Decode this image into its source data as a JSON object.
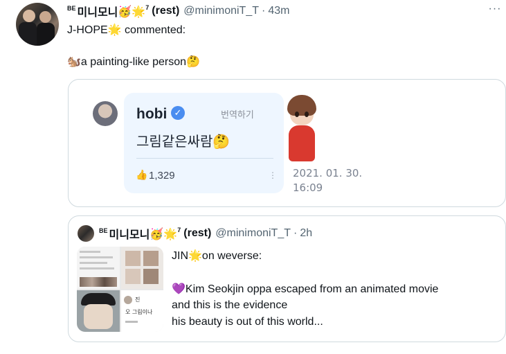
{
  "tweet": {
    "be_tag": "BE",
    "display_name": "미니모니",
    "name_emoji": "🥳",
    "star_emoji": "🌟",
    "superscript": "7",
    "rest_label": "(rest)",
    "handle": "@minimoniT_T",
    "separator": "·",
    "time": "43m",
    "more": "···",
    "line1_pre": "J-HOPE",
    "line1_emoji": "🌟",
    "line1_post": "commented:",
    "line2_emoji": "🐿️",
    "line2_text": "a painting-like person",
    "line2_emoji_end": "🤔"
  },
  "media_card": {
    "username": "hobi",
    "verified": "✓",
    "translate": "번역하기",
    "comment": "그림같은싸람",
    "comment_emoji": "🤔",
    "thumb": "👍",
    "like_count": "1,329",
    "dots": "⋮",
    "date_line1": "2021. 01. 30.",
    "date_line2": "16:09"
  },
  "quote": {
    "be_tag": "BE",
    "display_name": "미니모니",
    "name_emoji": "🥳",
    "star_emoji": "🌟",
    "superscript": "7",
    "rest_label": "(rest)",
    "handle": "@minimoniT_T",
    "separator": "·",
    "time": "2h",
    "line1_pre": "JIN",
    "line1_emoji": "🌟",
    "line1_post": "on weverse:",
    "heart": "💜",
    "line2": "Kim Seokjin oppa escaped from an animated movie",
    "line3": "and this is the evidence",
    "line4": "his beauty is out of this world...",
    "thumb_tile4_name": "진",
    "thumb_tile4_text": "오 그림이나"
  },
  "colors": {
    "text": "#0f1419",
    "muted": "#536471",
    "border": "#cfd9de",
    "bubble": "#eef6ff",
    "verified": "#4a8df0"
  }
}
